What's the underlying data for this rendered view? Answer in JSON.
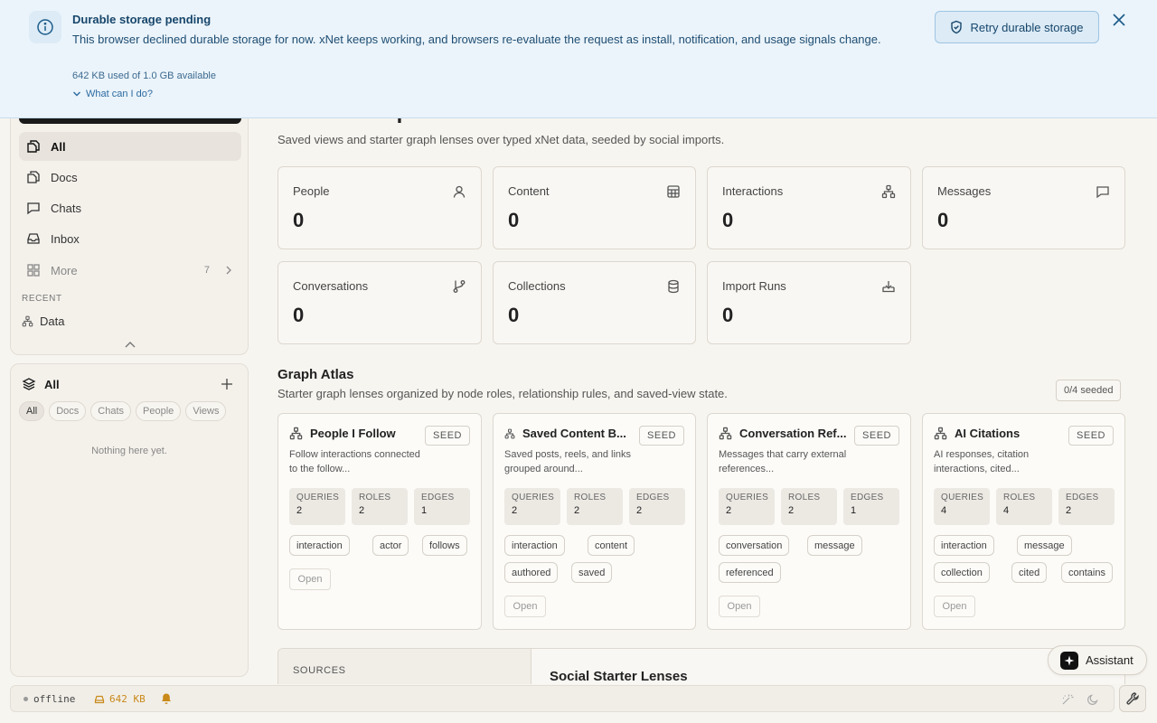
{
  "banner": {
    "title": "Durable storage pending",
    "message": "This browser declined durable storage for now. xNet keeps working, and browsers re-evaluate the request as install, notification, and usage signals change.",
    "usage": "642 KB used of 1.0 GB available",
    "help_link": "What can I do?",
    "retry_label": "Retry durable storage",
    "accent_color": "#1d5c8a"
  },
  "nav": {
    "items": [
      {
        "label": "All",
        "icon": "files-icon"
      },
      {
        "label": "Docs",
        "icon": "file-icon"
      },
      {
        "label": "Chats",
        "icon": "chat-icon"
      },
      {
        "label": "Inbox",
        "icon": "inbox-icon"
      },
      {
        "label": "More",
        "icon": "grid-icon",
        "count": "7"
      }
    ],
    "recent_label": "RECENT",
    "recent_items": [
      {
        "label": "Data",
        "icon": "graph-icon"
      }
    ]
  },
  "library": {
    "title": "All",
    "chips": [
      "All",
      "Docs",
      "Chats",
      "People",
      "Views"
    ],
    "empty_text": "Nothing here yet."
  },
  "main": {
    "title": "Data Workspace",
    "subtitle": "Saved views and starter graph lenses over typed xNet data, seeded by social imports.",
    "stats": [
      {
        "label": "People",
        "value": "0",
        "icon": "person-icon"
      },
      {
        "label": "Content",
        "value": "0",
        "icon": "table-icon"
      },
      {
        "label": "Interactions",
        "value": "0",
        "icon": "network-icon"
      },
      {
        "label": "Messages",
        "value": "0",
        "icon": "message-icon"
      },
      {
        "label": "Conversations",
        "value": "0",
        "icon": "branch-icon"
      },
      {
        "label": "Collections",
        "value": "0",
        "icon": "database-icon"
      },
      {
        "label": "Import Runs",
        "value": "0",
        "icon": "import-icon"
      }
    ]
  },
  "atlas": {
    "title": "Graph Atlas",
    "subtitle": "Starter graph lenses organized by node roles, relationship rules, and saved-view state.",
    "seeded": "0/4 seeded",
    "metric_labels": {
      "queries": "QUERIES",
      "roles": "ROLES",
      "edges": "EDGES"
    },
    "seed_label": "SEED",
    "open_label": "Open",
    "lenses": [
      {
        "name": "People I Follow",
        "desc": "Follow interactions connected to the follow...",
        "queries": "2",
        "roles": "2",
        "edges": "1",
        "tags": [
          "interaction",
          "actor",
          "follows"
        ]
      },
      {
        "name": "Saved Content B...",
        "desc": "Saved posts, reels, and links grouped around...",
        "queries": "2",
        "roles": "2",
        "edges": "2",
        "tags": [
          "interaction",
          "content",
          "authored",
          "saved"
        ]
      },
      {
        "name": "Conversation Ref...",
        "desc": "Messages that carry external references...",
        "queries": "2",
        "roles": "2",
        "edges": "1",
        "tags": [
          "conversation",
          "message",
          "referenced"
        ]
      },
      {
        "name": "AI Citations",
        "desc": "AI responses, citation interactions, cited...",
        "queries": "4",
        "roles": "4",
        "edges": "2",
        "tags": [
          "interaction",
          "message",
          "collection",
          "cited",
          "contains"
        ]
      }
    ]
  },
  "sources": {
    "label": "SOURCES",
    "starter_title": "Social Starter Lenses"
  },
  "assistant": {
    "label": "Assistant"
  },
  "status": {
    "connection": "offline",
    "storage": "642 KB",
    "warning_color": "#c98a1a"
  }
}
